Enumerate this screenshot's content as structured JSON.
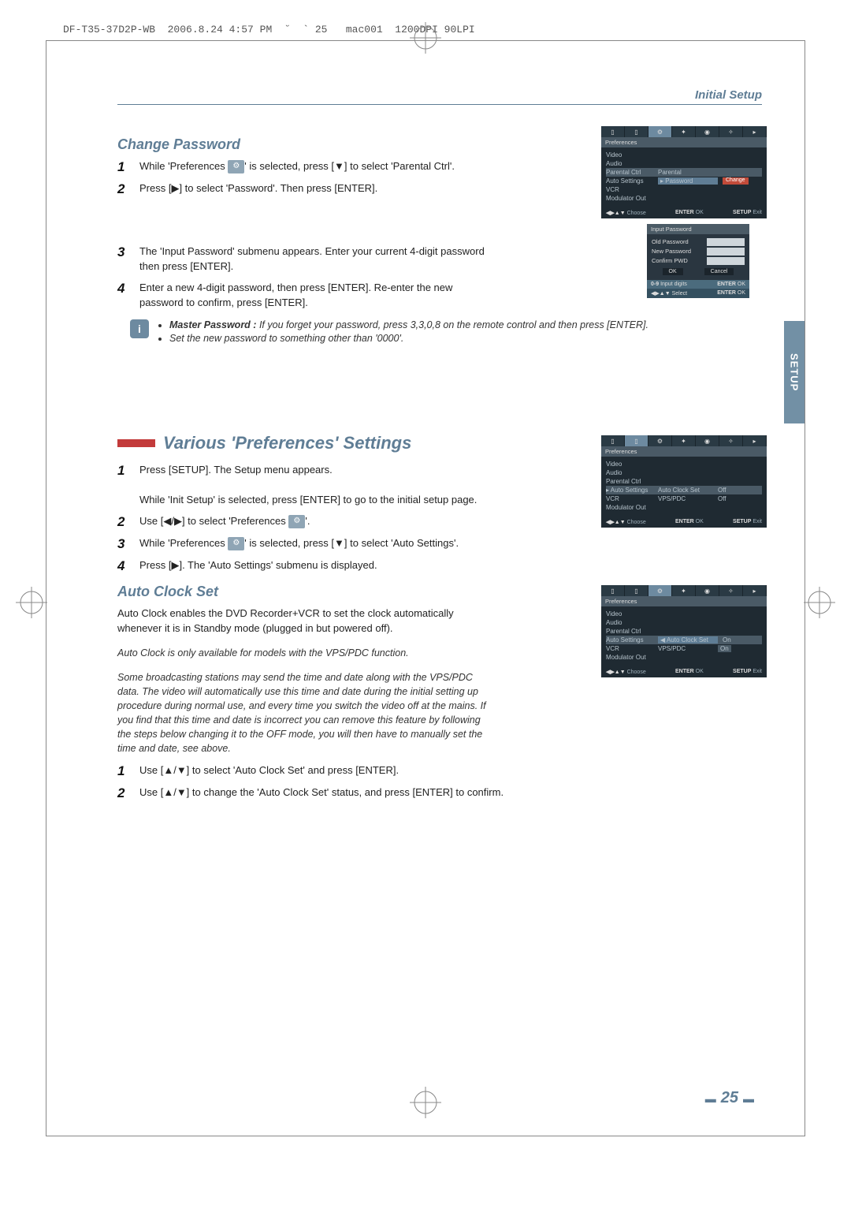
{
  "meta_header": "DF-T35-37D2P-WB  2006.8.24 4:57 PM  ˘  ` 25   mac001  1200DPI 90LPI",
  "section_header": "Initial Setup",
  "side_tab": "SETUP",
  "page_number": "25",
  "change_password": {
    "heading": "Change Password",
    "steps": [
      "While 'Preferences {icon}' is selected, press [▼] to select 'Parental Ctrl'.",
      "Press [▶] to select 'Password'. Then press [ENTER].",
      "The 'Input Password' submenu appears. Enter your current 4-digit password then press [ENTER].",
      "Enter a new 4-digit password, then press [ENTER]. Re-enter the new password to confirm, press [ENTER]."
    ],
    "notes": [
      "Master Password : If you forget your password, press 3,3,0,8 on the remote control and then press [ENTER].",
      "Set the new password to something other than '0000'."
    ]
  },
  "various_prefs": {
    "heading": "Various 'Preferences' Settings",
    "steps": [
      "Press [SETUP].  The Setup menu appears.",
      "While 'Init Setup' is selected, press [ENTER] to go to the initial setup page.",
      "Use [◀/▶] to select 'Preferences {icon}'.",
      "While 'Preferences {icon}' is selected, press [▼] to select 'Auto Settings'.",
      "Press [▶]. The 'Auto Settings' submenu is displayed."
    ]
  },
  "auto_clock": {
    "heading": "Auto Clock Set",
    "intro": "Auto Clock enables the DVD Recorder+VCR to set the clock automatically whenever it is in Standby mode (plugged in but powered off).",
    "italic1": "Auto Clock is only available for models with the VPS/PDC function.",
    "italic2": "Some broadcasting stations may send the time and date along with the VPS/PDC data. The video will automatically use this time and date during the initial setting up procedure during normal use, and every time you switch the video off at the mains. If you find that this time and date is incorrect you can remove this feature by following the steps below changing it to the OFF mode, you will then have to manually set the time and date, see above.",
    "steps": [
      "Use [▲/▼] to select 'Auto Clock Set' and press [ENTER].",
      "Use [▲/▼] to change the 'Auto Clock Set' status, and press [ENTER] to confirm."
    ]
  },
  "shot_common": {
    "bar_label": "Preferences",
    "menu_items": [
      "Video",
      "Audio",
      "Parental Ctrl",
      "Auto Settings",
      "VCR",
      "Modulator Out"
    ],
    "footer_choose": "Choose",
    "footer_ok": "OK",
    "footer_exit": "Exit",
    "footer_enter": "ENTER",
    "footer_setup": "SETUP",
    "arrows": "◀▶▲▼"
  },
  "shot1": {
    "parental_col2": "Parental",
    "password_col2": "Password",
    "change_btn": "Change"
  },
  "shot2": {
    "autoclock": "Auto Clock Set",
    "vpspdc": "VPS/PDC",
    "off": "Off"
  },
  "shot3": {
    "autoclock": "Auto Clock Set",
    "vpspdc": "VPS/PDC",
    "on": "On"
  },
  "dialog": {
    "title": "Input Password",
    "rows": [
      "Old Password",
      "New Password",
      "Confirm PWD"
    ],
    "ok": "OK",
    "cancel": "Cancel",
    "input_digits": "Input digits",
    "select": "Select",
    "enter_ok": "OK",
    "btn_09": "0-9",
    "btn_enter": "ENTER"
  }
}
